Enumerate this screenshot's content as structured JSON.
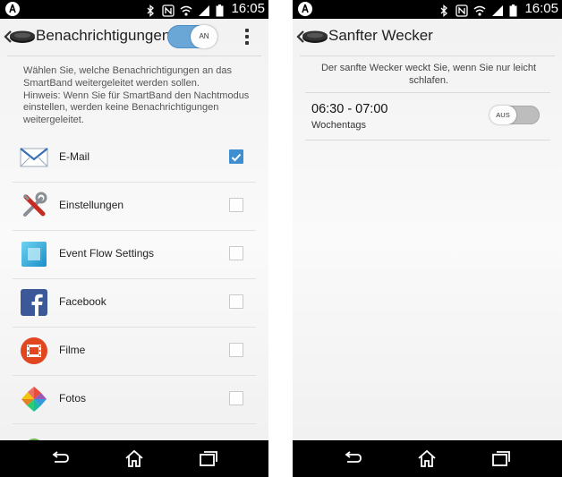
{
  "left": {
    "status": {
      "time": "16:05",
      "icons": [
        "bluetooth-icon",
        "nfc-icon",
        "wifi-icon",
        "signal-icon",
        "battery-icon"
      ]
    },
    "title": "Benachrichtigungen",
    "master_toggle": {
      "label": "AN",
      "on": true
    },
    "description": "Wählen Sie, welche Benachrichtigungen an das SmartBand weitergeleitet werden sollen.\nHinweis: Wenn Sie für SmartBand den Nachtmodus einstellen, werden keine Benachrichtigungen weitergeleitet.",
    "apps": [
      {
        "label": "E-Mail",
        "checked": true,
        "icon": "email-icon"
      },
      {
        "label": "Einstellungen",
        "checked": false,
        "icon": "settings-tools-icon"
      },
      {
        "label": "Event Flow Settings",
        "checked": false,
        "icon": "event-flow-icon"
      },
      {
        "label": "Facebook",
        "checked": false,
        "icon": "facebook-icon"
      },
      {
        "label": "Filme",
        "checked": false,
        "icon": "movies-icon"
      },
      {
        "label": "Fotos",
        "checked": false,
        "icon": "photos-icon"
      }
    ]
  },
  "right": {
    "status": {
      "time": "16:05",
      "icons": [
        "bluetooth-icon",
        "nfc-icon",
        "wifi-icon",
        "signal-icon",
        "battery-icon"
      ]
    },
    "title": "Sanfter Wecker",
    "description": "Der sanfte Wecker weckt Sie, wenn Sie nur leicht schlafen.",
    "alarm": {
      "time": "06:30 - 07:00",
      "days": "Wochentags",
      "toggle_label": "AUS",
      "on": false
    }
  },
  "colors": {
    "accent": "#3d8fd1",
    "toggle_on": "#6aa6d6",
    "toggle_off": "#bdbdbd",
    "statusbar": "#000000"
  }
}
